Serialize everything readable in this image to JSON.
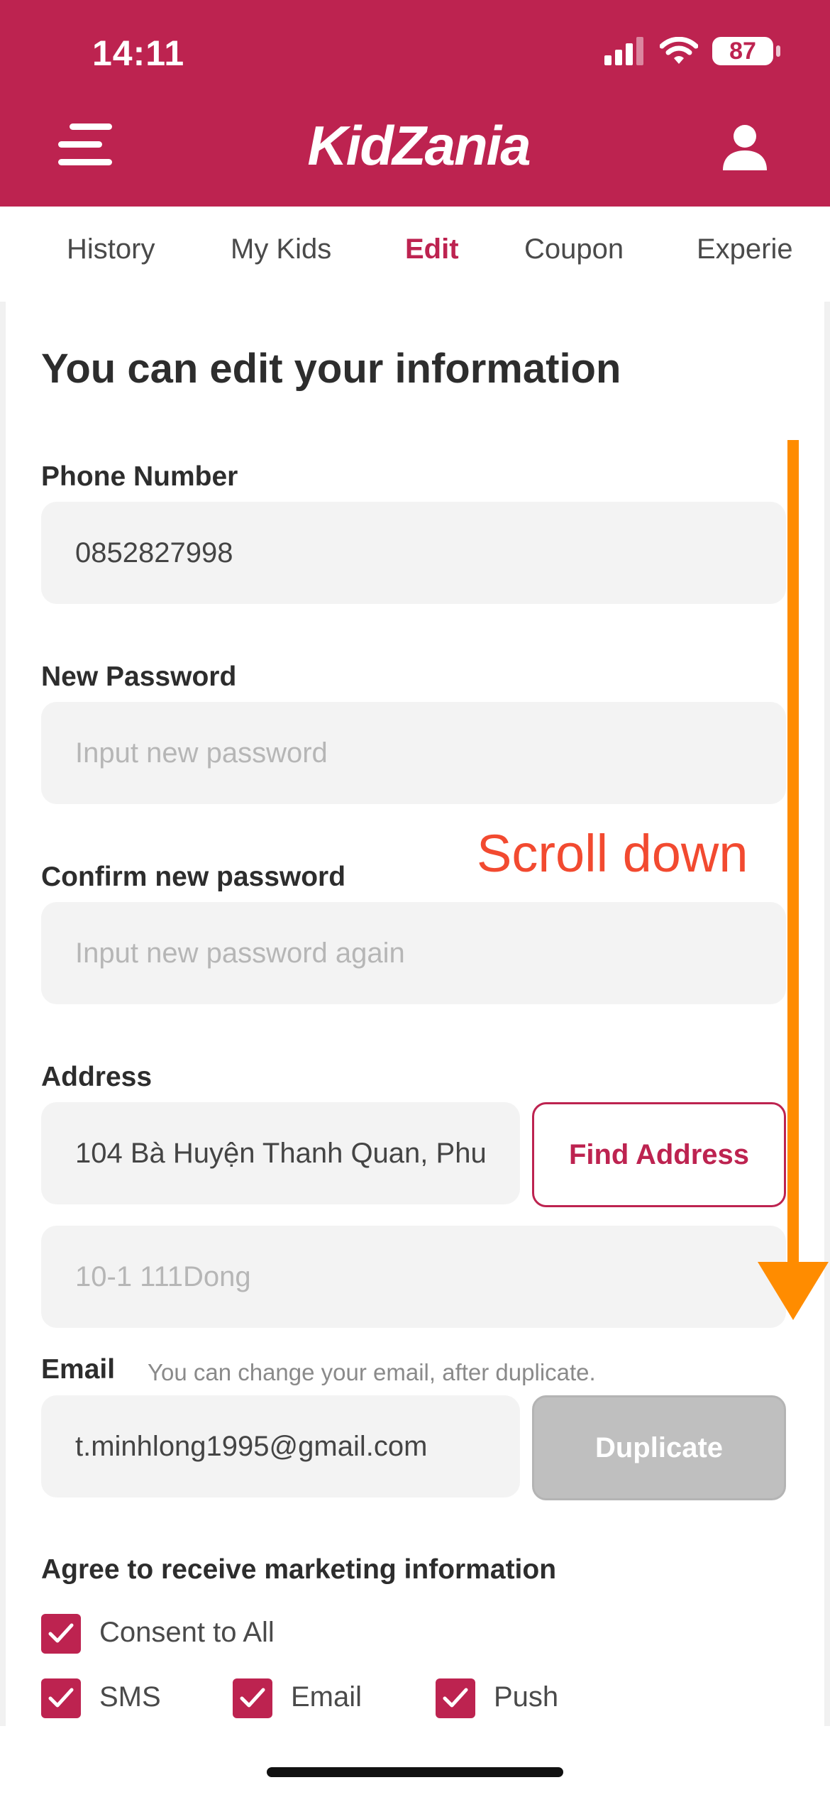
{
  "status": {
    "time": "14:11",
    "battery": "87"
  },
  "header": {
    "logo": "KidZania",
    "menu_icon": "hamburger-menu-icon",
    "user_icon": "user-icon"
  },
  "tabs": [
    {
      "label": "History"
    },
    {
      "label": "My Kids"
    },
    {
      "label": "Edit"
    },
    {
      "label": "Coupon"
    },
    {
      "label": "Experie"
    }
  ],
  "form": {
    "title": "You can edit your information",
    "phone": {
      "label": "Phone Number",
      "value": "0852827998"
    },
    "new_password": {
      "label": "New Password",
      "placeholder": "Input new password"
    },
    "confirm_password": {
      "label": "Confirm new password",
      "placeholder": "Input new password again"
    },
    "address": {
      "label": "Address",
      "value": "104 Bà Huyện Thanh Quan, Phu",
      "find_button": "Find Address",
      "detail_placeholder": "10-1 111Dong"
    },
    "email": {
      "label": "Email",
      "hint": "You can change your email, after duplicate.",
      "value": "t.minhlong1995@gmail.com",
      "duplicate_button": "Duplicate"
    },
    "marketing": {
      "label": "Agree to receive marketing information",
      "consent_all": "Consent to All",
      "options": [
        "SMS",
        "Email",
        "Push"
      ]
    }
  },
  "annotation": {
    "text": "Scroll down"
  },
  "colors": {
    "brand": "#bd2350",
    "annotation_text": "#f24a30",
    "annotation_arrow": "#ff8c00"
  }
}
